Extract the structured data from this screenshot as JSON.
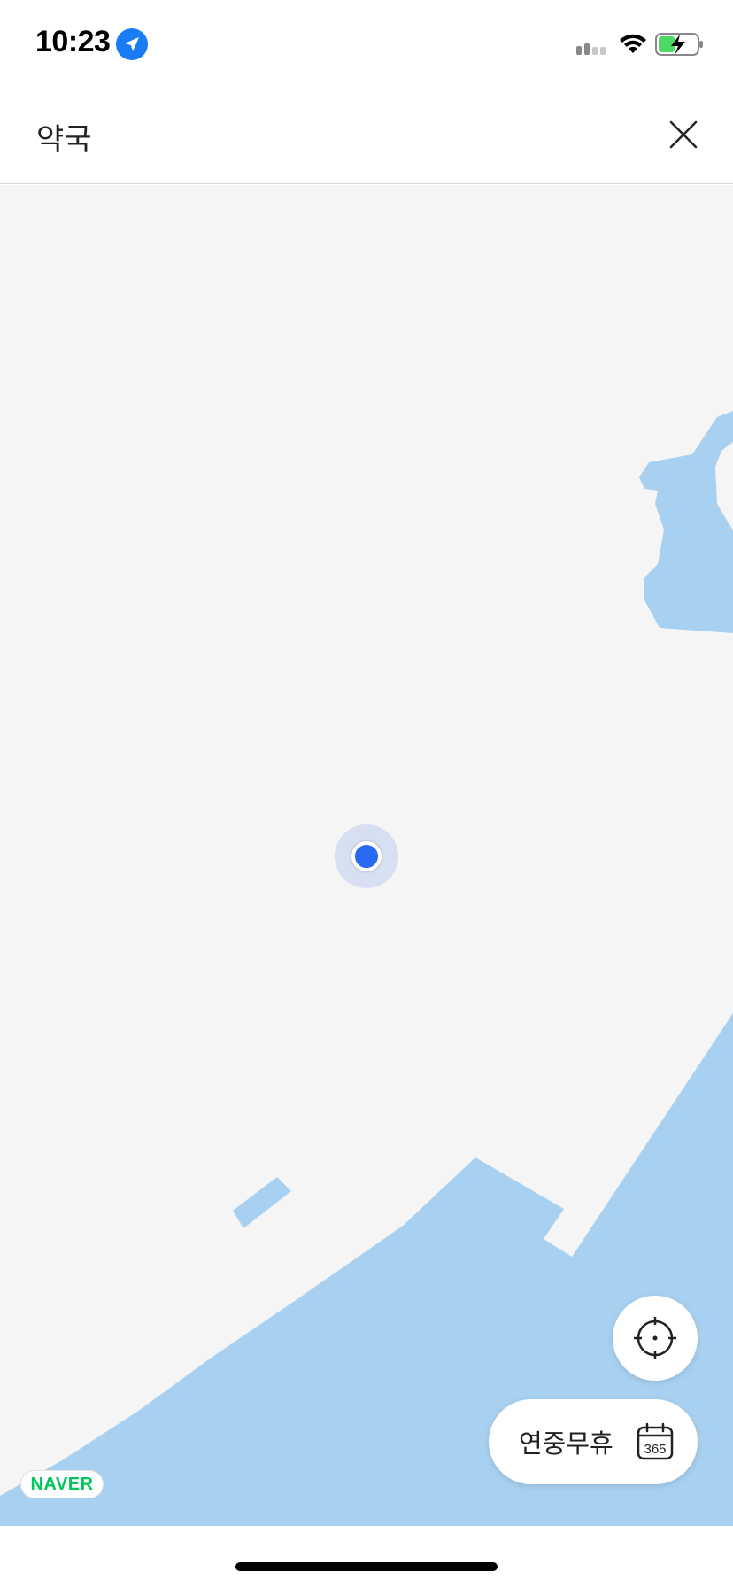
{
  "status_bar": {
    "time": "10:23"
  },
  "header": {
    "title": "약국"
  },
  "map": {
    "land_color": "#f5f5f5",
    "water_color": "#a8d1f1",
    "attribution": "NAVER"
  },
  "filter_button": {
    "label": "연중무휴",
    "icon_text": "365"
  },
  "colors": {
    "accent": "#2a6af0",
    "naver_green": "#03c75a"
  }
}
